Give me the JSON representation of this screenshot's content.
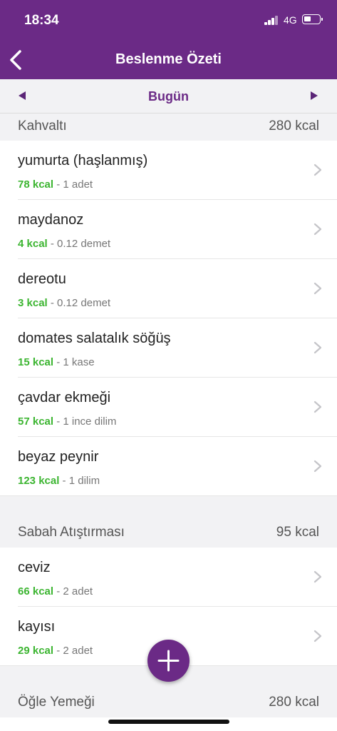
{
  "status_bar": {
    "time": "18:34",
    "network": "4G"
  },
  "nav": {
    "title": "Beslenme Özeti"
  },
  "day_selector": {
    "label": "Bugün"
  },
  "sections": [
    {
      "name": "Kahvaltı",
      "kcal": "280 kcal",
      "items": [
        {
          "food": "yumurta (haşlanmış)",
          "kcal": "78 kcal",
          "amount": " - 1 adet"
        },
        {
          "food": "maydanoz",
          "kcal": "4 kcal",
          "amount": " - 0.12 demet"
        },
        {
          "food": "dereotu",
          "kcal": "3 kcal",
          "amount": " - 0.12 demet"
        },
        {
          "food": "domates salatalık söğüş",
          "kcal": "15 kcal",
          "amount": " - 1 kase"
        },
        {
          "food": "çavdar ekmeği",
          "kcal": "57 kcal",
          "amount": " - 1 ince dilim"
        },
        {
          "food": "beyaz peynir",
          "kcal": "123 kcal",
          "amount": " - 1 dilim"
        }
      ]
    },
    {
      "name": "Sabah Atıştırması",
      "kcal": "95 kcal",
      "items": [
        {
          "food": "ceviz",
          "kcal": "66 kcal",
          "amount": " - 2 adet"
        },
        {
          "food": "kayısı",
          "kcal": "29 kcal",
          "amount": " - 2 adet"
        }
      ]
    },
    {
      "name": "Öğle Yemeği",
      "kcal": "280 kcal",
      "items": []
    }
  ],
  "colors": {
    "brand": "#6b2a86",
    "calorie": "#3cb531"
  },
  "icons": [
    "back-chevron-icon",
    "prev-day-icon",
    "next-day-icon",
    "chevron-right-icon",
    "plus-icon"
  ]
}
